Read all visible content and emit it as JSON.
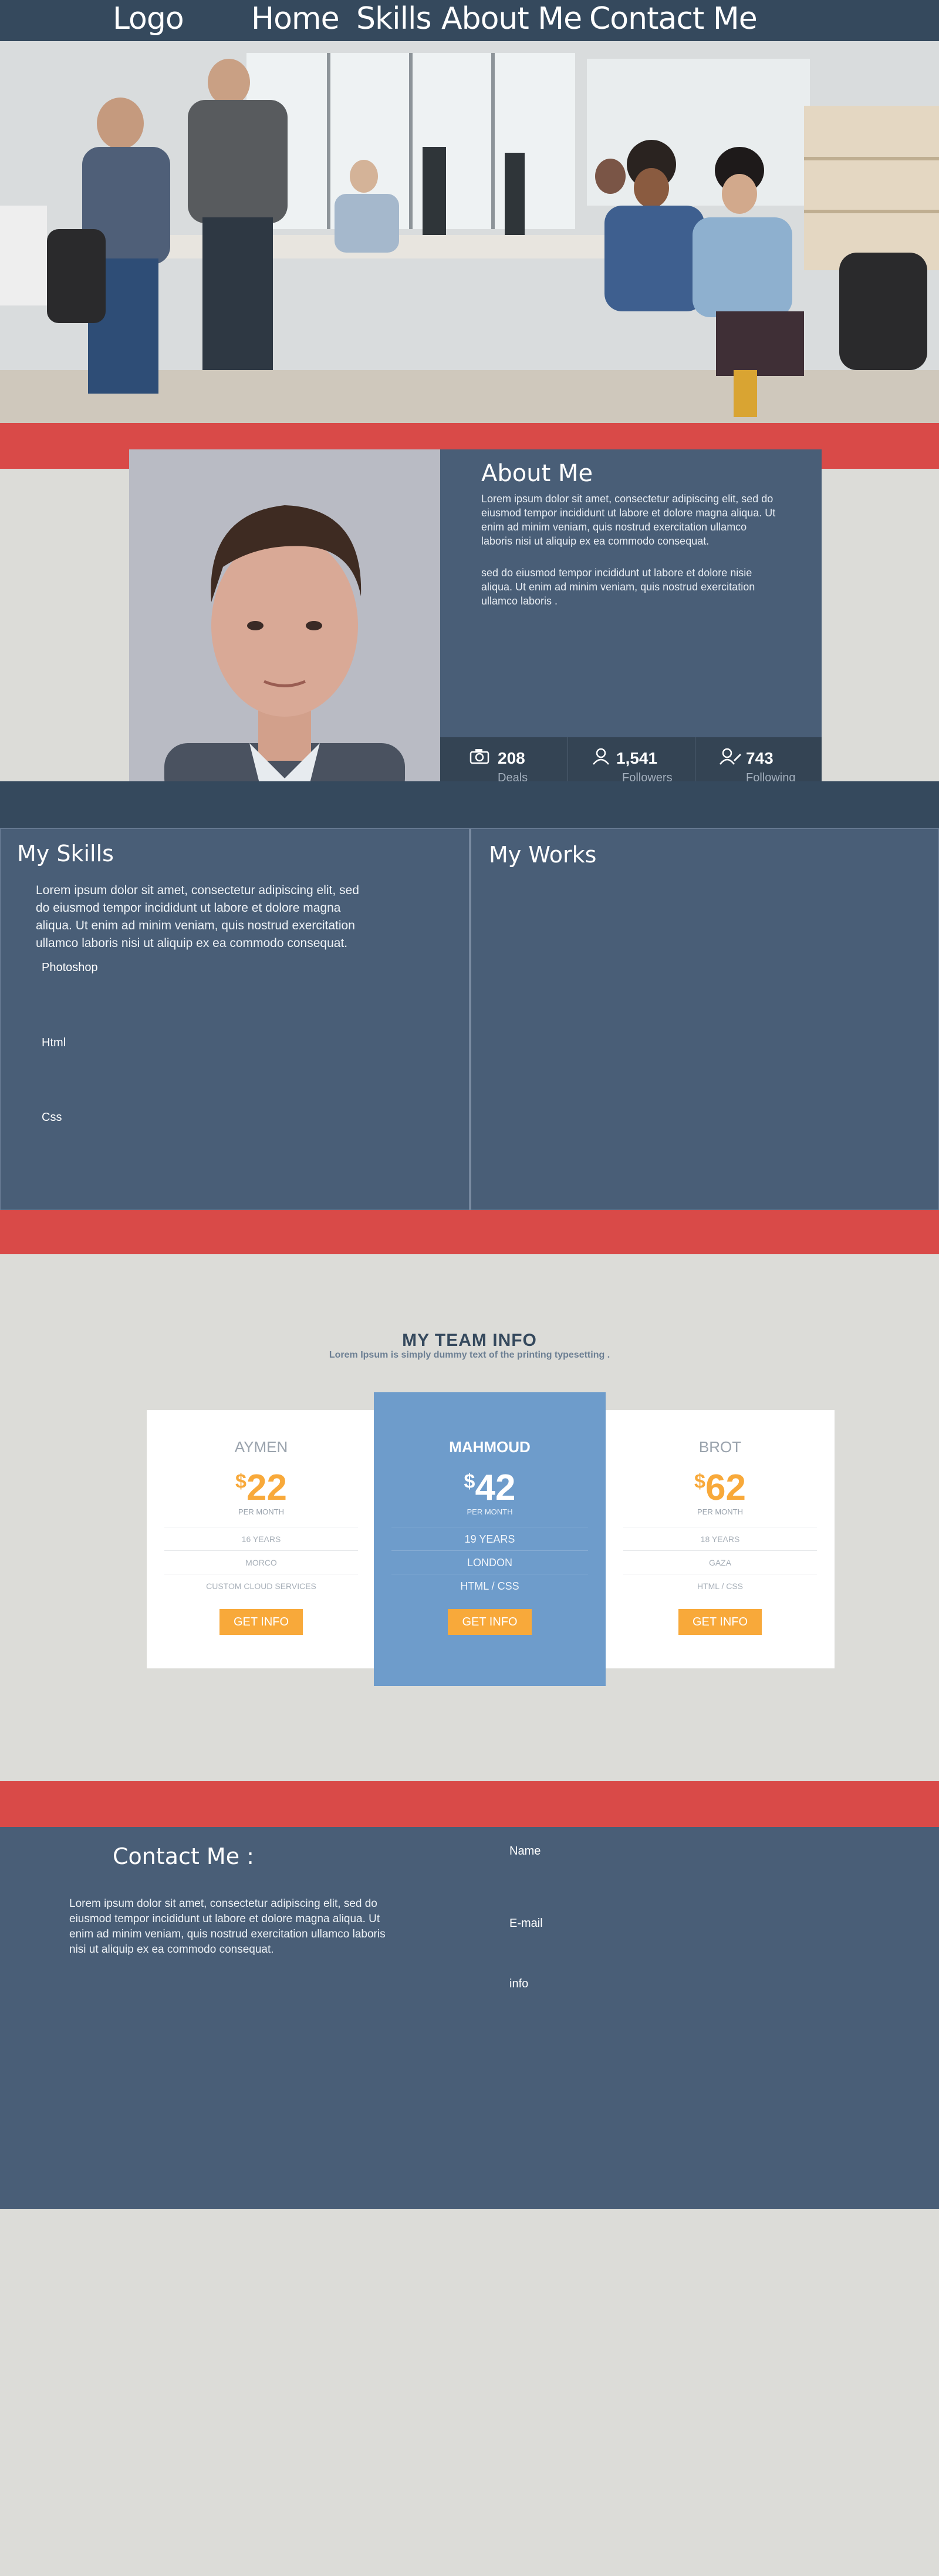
{
  "nav": {
    "logo": "Logo",
    "links": [
      "Home",
      "Skills",
      "About Me",
      "Contact Me"
    ]
  },
  "hero": {
    "image": "office-team-photo"
  },
  "about": {
    "title": "About Me",
    "para1": "Lorem ipsum dolor sit amet, consectetur adipiscing elit, sed do eiusmod tempor incididunt ut labore et dolore magna aliqua. Ut enim ad minim veniam, quis nostrud exercitation ullamco laboris nisi ut aliquip ex ea commodo consequat.",
    "para2": "sed do eiusmod tempor incididunt ut labore et dolore nisie aliqua. Ut enim ad minim veniam, quis nostrud exercitation ullamco laboris .",
    "stats": [
      {
        "icon": "camera-icon",
        "value": "208",
        "label": "Deals"
      },
      {
        "icon": "user-icon",
        "value": "1,541",
        "label": "Followers"
      },
      {
        "icon": "user-edit-icon",
        "value": "743",
        "label": "Following"
      }
    ]
  },
  "skills": {
    "title": "My Skills",
    "text": "Lorem ipsum dolor sit amet, consectetur adipiscing elit, sed do eiusmod tempor incididunt ut labore et dolore magna aliqua. Ut enim ad minim veniam, quis nostrud exercitation ullamco laboris nisi ut aliquip ex ea commodo consequat.",
    "items": [
      "Photoshop",
      "Html",
      "Css"
    ]
  },
  "works": {
    "title": "My Works"
  },
  "team": {
    "title": "MY TEAM INFO",
    "subtitle": "Lorem Ipsum is simply dummy text of the printing typesetting .",
    "cards": [
      {
        "name": "AYMEN",
        "currency": "$",
        "price": "22",
        "per": "PER MONTH",
        "rows": [
          "16 YEARS",
          "MORCO",
          "CUSTOM CLOUD SERVICES"
        ],
        "button": "GET INFO"
      },
      {
        "name": "MAHMOUD",
        "currency": "$",
        "price": "42",
        "per": "PER MONTH",
        "rows": [
          "19 YEARS",
          "LONDON",
          "HTML / CSS"
        ],
        "button": "GET INFO"
      },
      {
        "name": "BROT",
        "currency": "$",
        "price": "62",
        "per": "PER MONTH",
        "rows": [
          "18 YEARS",
          "GAZA",
          "HTML / CSS"
        ],
        "button": "GET INFO"
      }
    ]
  },
  "contact": {
    "title": "Contact Me :",
    "text": "Lorem ipsum dolor sit amet, consectetur adipiscing elit, sed do eiusmod tempor incididunt ut labore et dolore magna aliqua. Ut enim ad minim veniam, quis nostrud exercitation ullamco laboris nisi ut aliquip ex ea commodo consequat.",
    "fields": [
      "Name",
      "E-mail",
      "info"
    ]
  },
  "colors": {
    "nav": "#35495d",
    "panel": "#495e77",
    "accent_red": "#d94a48",
    "accent_orange": "#f8a93a",
    "featured_card": "#6e9ccb",
    "background": "#dcdcd8"
  }
}
